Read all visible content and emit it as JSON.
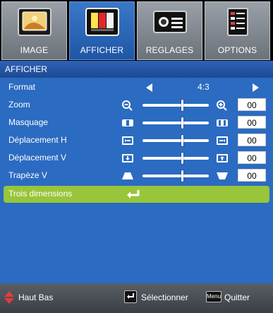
{
  "tabs": [
    {
      "label": "IMAGE",
      "icon": "image-icon",
      "active": false
    },
    {
      "label": "AFFICHER",
      "icon": "display-icon",
      "active": true
    },
    {
      "label": "REGLAGES",
      "icon": "projector-settings-icon",
      "active": false
    },
    {
      "label": "OPTIONS",
      "icon": "options-list-icon",
      "active": false
    }
  ],
  "header": {
    "title": "AFFICHER"
  },
  "menu": {
    "items": [
      {
        "label": "Format",
        "value": "4:3",
        "type": "select"
      },
      {
        "label": "Zoom",
        "value": "00",
        "type": "slider",
        "level": 0.6
      },
      {
        "label": "Masquage",
        "value": "00",
        "type": "slider",
        "level": 0.6
      },
      {
        "label": "Déplacement H",
        "value": "00",
        "type": "slider",
        "level": 0.6
      },
      {
        "label": "Déplacement V",
        "value": "00",
        "type": "slider",
        "level": 0.6
      },
      {
        "label": "Trapèze V",
        "value": "00",
        "type": "slider",
        "level": 0.6
      },
      {
        "label": "Trois dimensions",
        "type": "enter",
        "selected": true
      }
    ]
  },
  "footer": {
    "nav_label": "Haut Bas",
    "select_label": "Sélectionner",
    "menu_key": "Menu",
    "quit_label": "Quitter"
  },
  "colors": {
    "panel_blue": "#2b6bc1",
    "tab_active": "#2a66b8",
    "selected_row": "#98c53a",
    "footer_gray": "#4b5057",
    "accent_red": "#e53b3b"
  }
}
